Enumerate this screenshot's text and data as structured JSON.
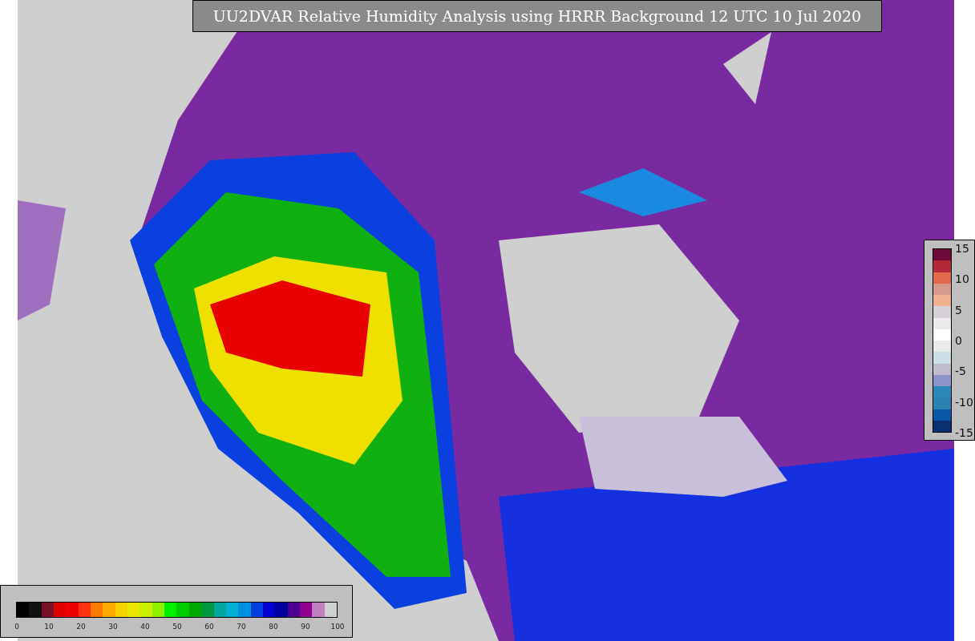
{
  "title": "UU2DVAR Relative Humidity Analysis using HRRR Background 12 UTC 10 Jul 2020",
  "humidity_colorbar": {
    "ticks": [
      "0",
      "10",
      "20",
      "30",
      "40",
      "50",
      "60",
      "70",
      "80",
      "90",
      "100"
    ],
    "segments": [
      {
        "color": "#000000"
      },
      {
        "color": "#111111"
      },
      {
        "color": "#7a0f2a"
      },
      {
        "color": "#e00000"
      },
      {
        "color": "#ee0000"
      },
      {
        "color": "#ff3010"
      },
      {
        "color": "#ff7a00"
      },
      {
        "color": "#ffaa00"
      },
      {
        "color": "#f5d200"
      },
      {
        "color": "#e8e800"
      },
      {
        "color": "#c8f000"
      },
      {
        "color": "#90f000"
      },
      {
        "color": "#00ee00"
      },
      {
        "color": "#00cc00"
      },
      {
        "color": "#00a800"
      },
      {
        "color": "#009840"
      },
      {
        "color": "#00a8a0"
      },
      {
        "color": "#00b0d0"
      },
      {
        "color": "#0090e0"
      },
      {
        "color": "#0040e0"
      },
      {
        "color": "#0000d0"
      },
      {
        "color": "#0000a0"
      },
      {
        "color": "#500090"
      },
      {
        "color": "#900090"
      },
      {
        "color": "#c080c0"
      },
      {
        "color": "#d0d0d0"
      }
    ]
  },
  "difference_colorbar": {
    "ticks": [
      "15",
      "10",
      "5",
      "0",
      "-5",
      "-10",
      "-15"
    ],
    "segments": [
      {
        "color": "#6e0a3a"
      },
      {
        "color": "#b22a3a"
      },
      {
        "color": "#e06a4a"
      },
      {
        "color": "#d59a8a"
      },
      {
        "color": "#f0b090"
      },
      {
        "color": "#d8d0d8"
      },
      {
        "color": "#ebebeb"
      },
      {
        "color": "#ffffff"
      },
      {
        "color": "#ebebeb"
      },
      {
        "color": "#cde0e8"
      },
      {
        "color": "#c0bccc"
      },
      {
        "color": "#8c94c8"
      },
      {
        "color": "#2c88b8"
      },
      {
        "color": "#2a80b0"
      },
      {
        "color": "#0a58a8"
      },
      {
        "color": "#0a3070"
      }
    ]
  }
}
